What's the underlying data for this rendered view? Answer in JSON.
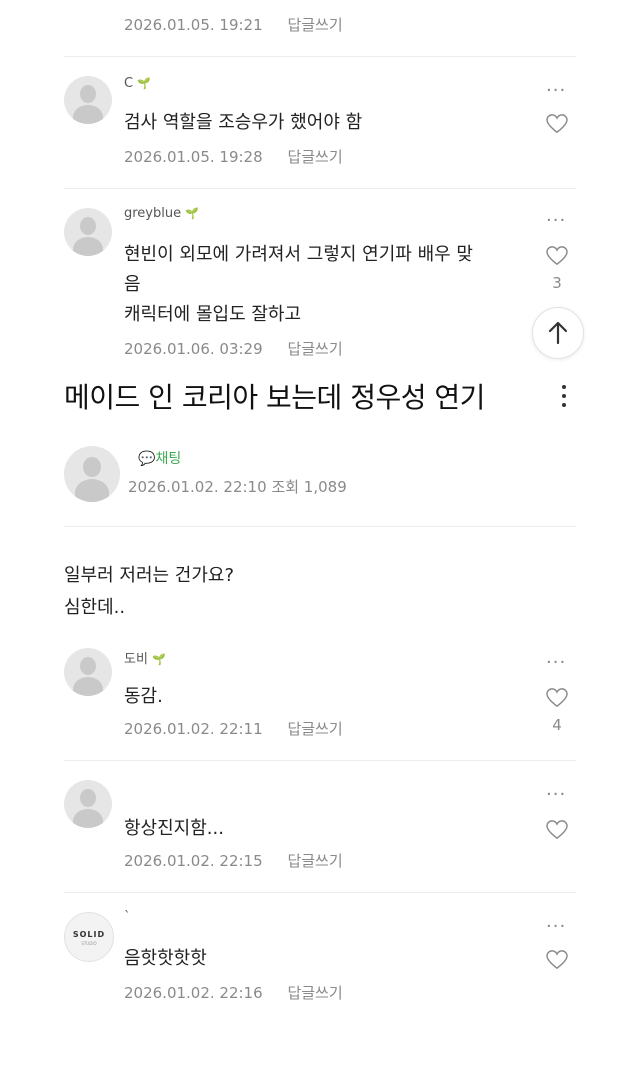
{
  "post": {
    "title": "메이드 인 코리아 보는데 정우성 연기",
    "author": "",
    "chat_label": "채팅",
    "date": "2026.01.02. 22:10",
    "views": "조회 1,089",
    "body": [
      "일부러 저러는 건가요?",
      "심한데.."
    ]
  },
  "comments_above": [
    {
      "name": "",
      "text": "",
      "date": "2026.01.05. 19:21",
      "reply": "답글쓰기"
    },
    {
      "name": "C",
      "text": "검사 역할을 조승우가 했어야 함",
      "date": "2026.01.05. 19:28",
      "reply": "답글쓰기"
    },
    {
      "name": "greyblue",
      "text_lines": [
        "현빈이 외모에 가려져서 그렇지 연기파 배우 맞",
        "음",
        "캐릭터에 몰입도 잘하고"
      ],
      "date": "2026.01.06. 03:29",
      "reply": "답글쓰기",
      "likes": "3"
    }
  ],
  "comments": [
    {
      "name": "도비",
      "text": "동감.",
      "date": "2026.01.02. 22:11",
      "reply": "답글쓰기",
      "likes": "4"
    },
    {
      "name": "",
      "text": "항상진지함...",
      "date": "2026.01.02. 22:15",
      "reply": "답글쓰기"
    },
    {
      "name": "`",
      "text": "음핫핫핫핫",
      "date": "2026.01.02. 22:16",
      "reply": "답글쓰기",
      "avatar_logo": "SOLID",
      "avatar_logo_sub": "STUDIO"
    }
  ],
  "icons": {
    "more": "more-icon",
    "heart": "heart-icon",
    "scroll": "arrow-up-icon",
    "sprout": "sprout-icon"
  },
  "glyphs": {
    "more": "···",
    "sprout": "🌱"
  },
  "colors": {
    "accent_green": "#3cab52",
    "meta_gray": "#8a8a8a"
  }
}
